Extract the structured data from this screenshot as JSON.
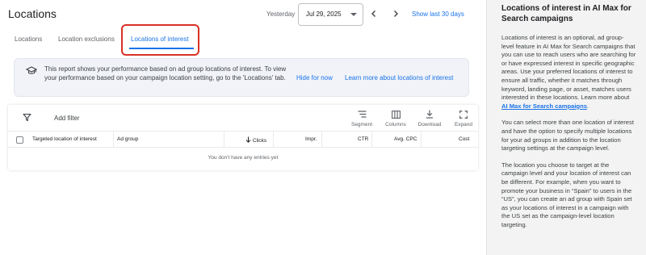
{
  "header": {
    "title": "Locations",
    "yesterday_label": "Yesterday",
    "date_value": "Jul 29, 2025",
    "show_last_label": "Show last 30 days"
  },
  "tabs": [
    {
      "label": "Locations"
    },
    {
      "label": "Location exclusions"
    },
    {
      "label": "Locations of interest",
      "active": true
    }
  ],
  "banner": {
    "text": "This report shows your performance based on ad group locations of interest. To view your performance based on your campaign location setting, go to the 'Locations' tab.",
    "hide_label": "Hide for now",
    "learn_label": "Learn more about locations of interest"
  },
  "toolbar": {
    "add_filter": "Add filter",
    "segment": "Segment",
    "columns": "Columns",
    "download": "Download",
    "expand": "Expand"
  },
  "table": {
    "headers": [
      "Targeted location of interest",
      "Ad group",
      "Clicks",
      "Impr.",
      "CTR",
      "Avg. CPC",
      "Cost"
    ],
    "empty_message": "You don't have any entries yet"
  },
  "side_panel": {
    "title": "Locations of interest in AI Max for Search campaigns",
    "p1_text": "Locations of interest is an optional, ad group-level feature in AI Max for Search campaigns that you can use to reach users who are searching for or have expressed interest in specific geographic areas. Use your preferred locations of interest to ensure all traffic, whether it matches through keyword, landing page, or asset, matches users interested in these locations. Learn more about ",
    "p1_link": "AI Max for Search campaigns",
    "p1_end": ".",
    "p2": "You can select more than one location of interest and have the option to specify multiple locations for your ad groups in addition to the location targeting settings at the campaign level.",
    "p3": "The location you choose to target at the campaign level and your location of interest can be different. For example, when you want to promote your business in “Spain” to users in the “US”, you can create an ad group with Spain set as your locations of interest in a campaign with the US set as the campaign-level location targeting."
  },
  "colors": {
    "accent": "#1a73e8",
    "highlight": "#d93025"
  }
}
